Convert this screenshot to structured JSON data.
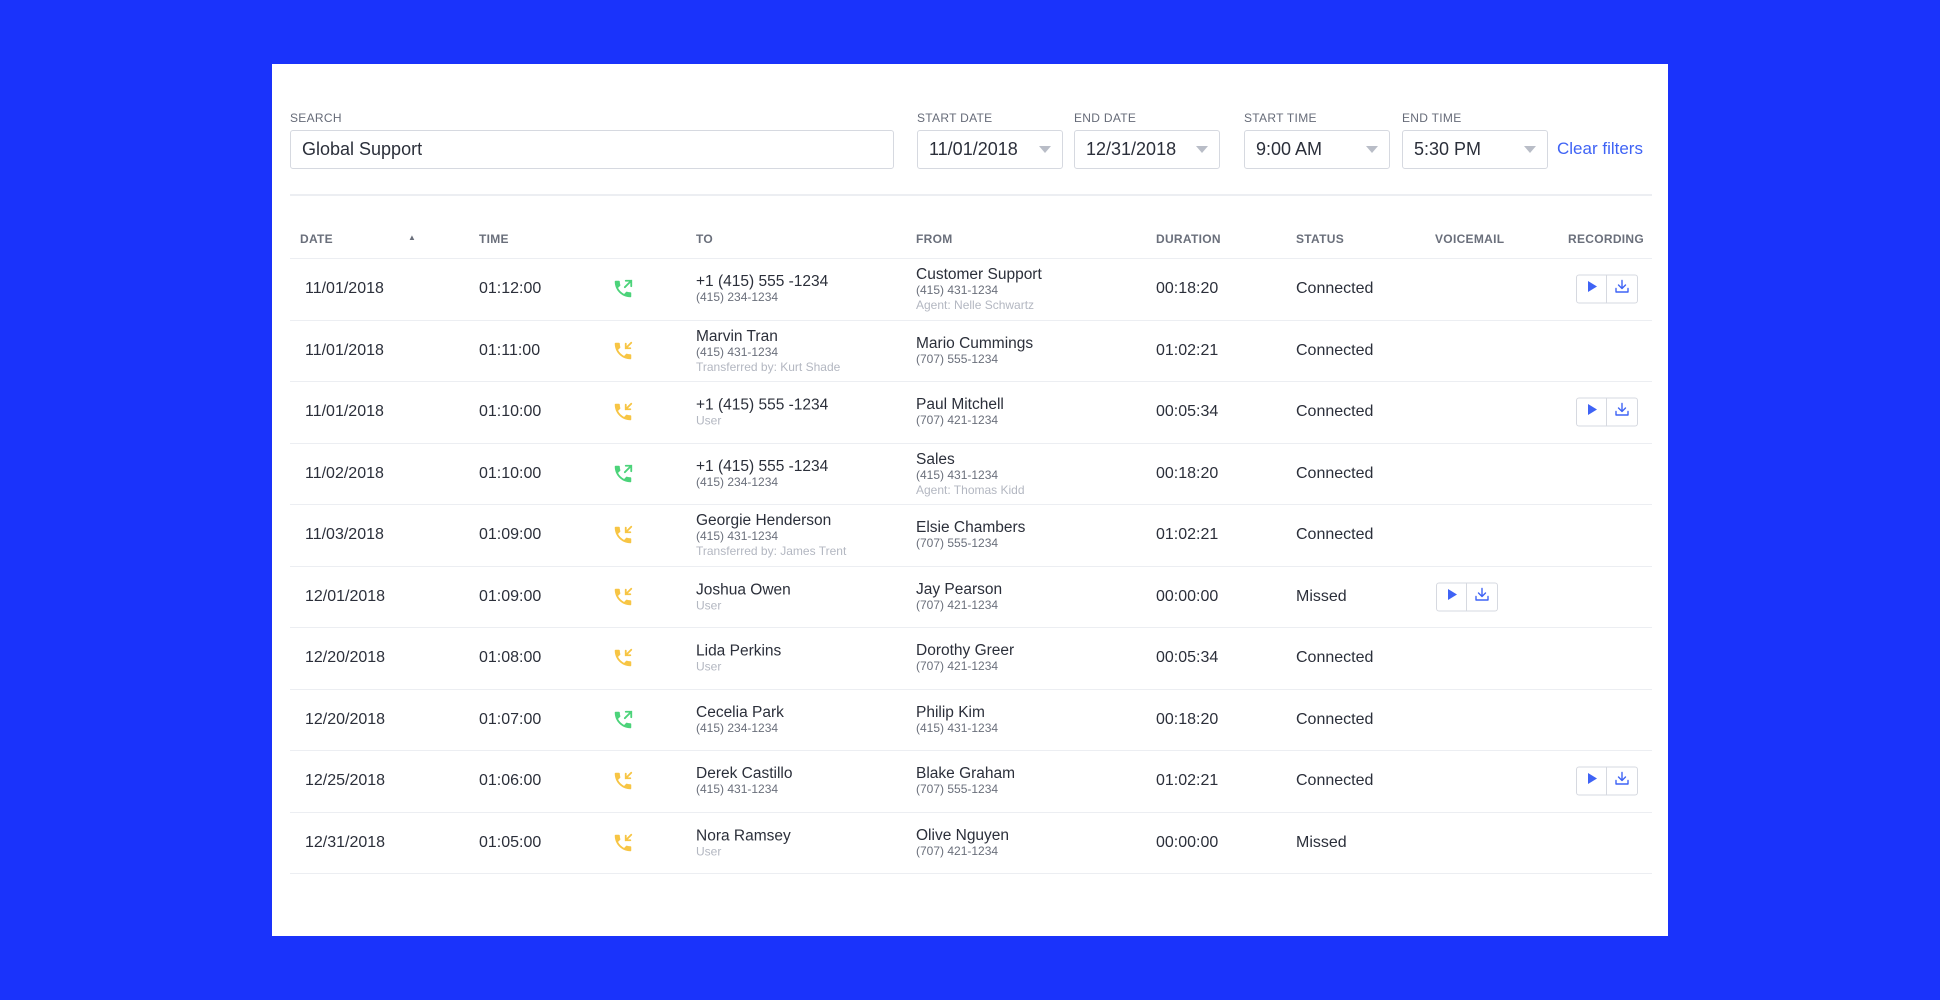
{
  "filters": {
    "search_label": "SEARCH",
    "search_value": "Global Support",
    "start_date_label": "START DATE",
    "start_date_value": "11/01/2018",
    "end_date_label": "END DATE",
    "end_date_value": "12/31/2018",
    "start_time_label": "START TIME",
    "start_time_value": "9:00 AM",
    "end_time_label": "END TIME",
    "end_time_value": "5:30 PM",
    "clear_label": "Clear filters"
  },
  "columns": {
    "date": "DATE",
    "time": "TIME",
    "to": "TO",
    "from": "FROM",
    "duration": "DURATION",
    "status": "STATUS",
    "voicemail": "VOICEMAIL",
    "recording": "RECORDING"
  },
  "colors": {
    "background": "#1a33fb",
    "accent": "#3f63f5",
    "outgoing_call": "#4cd37a",
    "incoming_call": "#f7c544"
  },
  "rows": [
    {
      "date": "11/01/2018",
      "time": "01:12:00",
      "call_icon": "outgoing-call-icon",
      "to_main": "+1 (415) 555 -1234",
      "to_sub": "(415) 234-1234",
      "to_note": "",
      "from_main": "Customer Support",
      "from_sub": "(415) 431-1234",
      "from_note": "Agent: Nelle Schwartz",
      "duration": "00:18:20",
      "status": "Connected",
      "voicemail": false,
      "recording": true
    },
    {
      "date": "11/01/2018",
      "time": "01:11:00",
      "call_icon": "incoming-call-icon",
      "to_main": "Marvin Tran",
      "to_sub": "(415) 431-1234",
      "to_note": "Transferred by: Kurt Shade",
      "from_main": "Mario Cummings",
      "from_sub": "(707) 555-1234",
      "from_note": "",
      "duration": "01:02:21",
      "status": "Connected",
      "voicemail": false,
      "recording": false
    },
    {
      "date": "11/01/2018",
      "time": "01:10:00",
      "call_icon": "incoming-call-icon",
      "to_main": "+1 (415) 555 -1234",
      "to_sub": "",
      "to_note": "User",
      "from_main": "Paul Mitchell",
      "from_sub": "(707) 421-1234",
      "from_note": "",
      "duration": "00:05:34",
      "status": "Connected",
      "voicemail": false,
      "recording": true
    },
    {
      "date": "11/02/2018",
      "time": "01:10:00",
      "call_icon": "outgoing-call-icon",
      "to_main": "+1 (415) 555 -1234",
      "to_sub": "(415) 234-1234",
      "to_note": "",
      "from_main": "Sales",
      "from_sub": "(415) 431-1234",
      "from_note": "Agent: Thomas Kidd",
      "duration": "00:18:20",
      "status": "Connected",
      "voicemail": false,
      "recording": false
    },
    {
      "date": "11/03/2018",
      "time": "01:09:00",
      "call_icon": "incoming-call-icon",
      "to_main": "Georgie Henderson",
      "to_sub": "(415) 431-1234",
      "to_note": "Transferred by: James Trent",
      "from_main": "Elsie Chambers",
      "from_sub": "(707) 555-1234",
      "from_note": "",
      "duration": "01:02:21",
      "status": "Connected",
      "voicemail": false,
      "recording": false
    },
    {
      "date": "12/01/2018",
      "time": "01:09:00",
      "call_icon": "incoming-call-icon",
      "to_main": "Joshua Owen",
      "to_sub": "",
      "to_note": "User",
      "from_main": "Jay Pearson",
      "from_sub": "(707) 421-1234",
      "from_note": "",
      "duration": "00:00:00",
      "status": "Missed",
      "voicemail": true,
      "recording": false
    },
    {
      "date": "12/20/2018",
      "time": "01:08:00",
      "call_icon": "incoming-call-icon",
      "to_main": "Lida Perkins",
      "to_sub": "",
      "to_note": "User",
      "from_main": "Dorothy Greer",
      "from_sub": "(707) 421-1234",
      "from_note": "",
      "duration": "00:05:34",
      "status": "Connected",
      "voicemail": false,
      "recording": false
    },
    {
      "date": "12/20/2018",
      "time": "01:07:00",
      "call_icon": "outgoing-call-icon",
      "to_main": "Cecelia Park",
      "to_sub": "(415) 234-1234",
      "to_note": "",
      "from_main": "Philip Kim",
      "from_sub": "(415) 431-1234",
      "from_note": "",
      "duration": "00:18:20",
      "status": "Connected",
      "voicemail": false,
      "recording": false
    },
    {
      "date": "12/25/2018",
      "time": "01:06:00",
      "call_icon": "incoming-call-icon",
      "to_main": "Derek Castillo",
      "to_sub": "(415) 431-1234",
      "to_note": "",
      "from_main": "Blake Graham",
      "from_sub": "(707) 555-1234",
      "from_note": "",
      "duration": "01:02:21",
      "status": "Connected",
      "voicemail": false,
      "recording": true
    },
    {
      "date": "12/31/2018",
      "time": "01:05:00",
      "call_icon": "incoming-call-icon",
      "to_main": "Nora Ramsey",
      "to_sub": "",
      "to_note": "User",
      "from_main": "Olive Nguyen",
      "from_sub": "(707) 421-1234",
      "from_note": "",
      "duration": "00:00:00",
      "status": "Missed",
      "voicemail": false,
      "recording": false
    }
  ]
}
